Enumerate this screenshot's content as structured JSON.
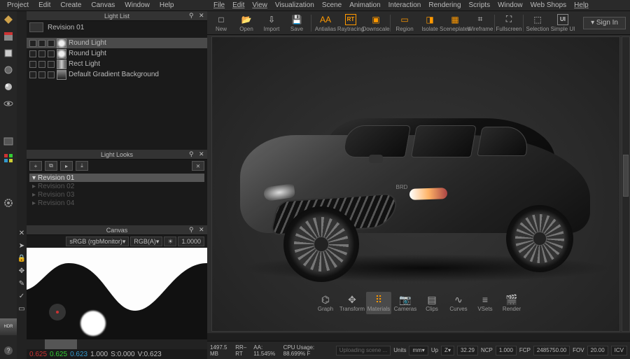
{
  "leftApp": {
    "menu": [
      "Project",
      "Edit",
      "Create",
      "Canvas",
      "Window",
      "Help"
    ],
    "panels": {
      "lightList": {
        "title": "Light List",
        "revision": "Revision 01",
        "items": [
          {
            "label": "Round Light",
            "thumb": "round",
            "active": true
          },
          {
            "label": "Round Light",
            "thumb": "round",
            "active": false
          },
          {
            "label": "Rect Light",
            "thumb": "rect",
            "active": false
          },
          {
            "label": "Default Gradient Background",
            "thumb": "grad",
            "active": false
          }
        ]
      },
      "lightLooks": {
        "title": "Light Looks",
        "items": [
          {
            "label": "Revision 01",
            "active": true
          },
          {
            "label": "Revision 02",
            "active": false
          },
          {
            "label": "Revision 03",
            "active": false
          },
          {
            "label": "Revision 04",
            "active": false
          }
        ]
      },
      "canvas": {
        "title": "Canvas",
        "colorspace": "sRGB (rgbMonitor)",
        "channels": "RGB(A)",
        "value": "1.0000",
        "status": {
          "r": "0.625",
          "g": "0.625",
          "b": "0.623",
          "w": "1.000",
          "s": "S:0.000",
          "v": "V:0.623"
        }
      }
    }
  },
  "rightApp": {
    "menu": [
      "File",
      "Edit",
      "View",
      "Visualization",
      "Scene",
      "Animation",
      "Interaction",
      "Rendering",
      "Scripts",
      "Window",
      "Web Shops",
      "Help"
    ],
    "toolbar": [
      {
        "name": "new",
        "label": "New",
        "icon": "□"
      },
      {
        "name": "open",
        "label": "Open",
        "icon": "📂"
      },
      {
        "name": "import",
        "label": "Import",
        "icon": "⇩"
      },
      {
        "name": "save",
        "label": "Save",
        "icon": "💾"
      },
      {
        "sep": true
      },
      {
        "name": "antialias",
        "label": "Antialias",
        "icon": "AA",
        "color": "#f90"
      },
      {
        "name": "raytracing",
        "label": "Raytracing",
        "icon": "RT",
        "color": "#f90",
        "boxed": true
      },
      {
        "name": "downscale",
        "label": "Downscale",
        "icon": "▣",
        "color": "#f90"
      },
      {
        "sep": true
      },
      {
        "name": "region",
        "label": "Region",
        "icon": "▭",
        "color": "#f90"
      },
      {
        "name": "isolate",
        "label": "Isolate",
        "icon": "◨",
        "color": "#f90"
      },
      {
        "name": "sceneplates",
        "label": "Sceneplates",
        "icon": "▦",
        "color": "#f90"
      },
      {
        "name": "wireframe",
        "label": "Wireframe",
        "icon": "⌗"
      },
      {
        "sep": true
      },
      {
        "name": "fullscreen",
        "label": "Fullscreen",
        "icon": "⛶"
      },
      {
        "sep": true
      },
      {
        "name": "selection",
        "label": "Selection",
        "icon": "⬚"
      },
      {
        "name": "simpleui",
        "label": "Simple UI",
        "icon": "UI",
        "boxed": true
      }
    ],
    "signIn": "Sign In",
    "viewportToolbar": [
      {
        "name": "graph",
        "label": "Graph",
        "icon": "⌬"
      },
      {
        "name": "transform",
        "label": "Transform",
        "icon": "✥"
      },
      {
        "name": "materials",
        "label": "Materials",
        "icon": "⠿",
        "active": true,
        "color": "#f90"
      },
      {
        "name": "cameras",
        "label": "Cameras",
        "icon": "📷"
      },
      {
        "name": "clips",
        "label": "Clips",
        "icon": "▤"
      },
      {
        "name": "curves",
        "label": "Curves",
        "icon": "∿"
      },
      {
        "name": "vsets",
        "label": "VSets",
        "icon": "≡"
      },
      {
        "name": "render",
        "label": "Render",
        "icon": "🎬"
      }
    ],
    "badge": "BRD",
    "status": {
      "mem": "1497.5 MB",
      "mode": "RR–RT",
      "aa": "AA: 11.545%",
      "cpu": "CPU Usage: 88.699%  F",
      "progress": "Uploading scene ...",
      "units_label": "Units",
      "units": "mm",
      "up_label": "Up",
      "up": "Z",
      "spinner": "32.29",
      "ncp_label": "NCP",
      "ncp": "1.000",
      "fcp_label": "FCP",
      "fcp": "2485750.00",
      "fov_label": "FOV",
      "fov": "20.00",
      "icv": "ICV"
    }
  }
}
